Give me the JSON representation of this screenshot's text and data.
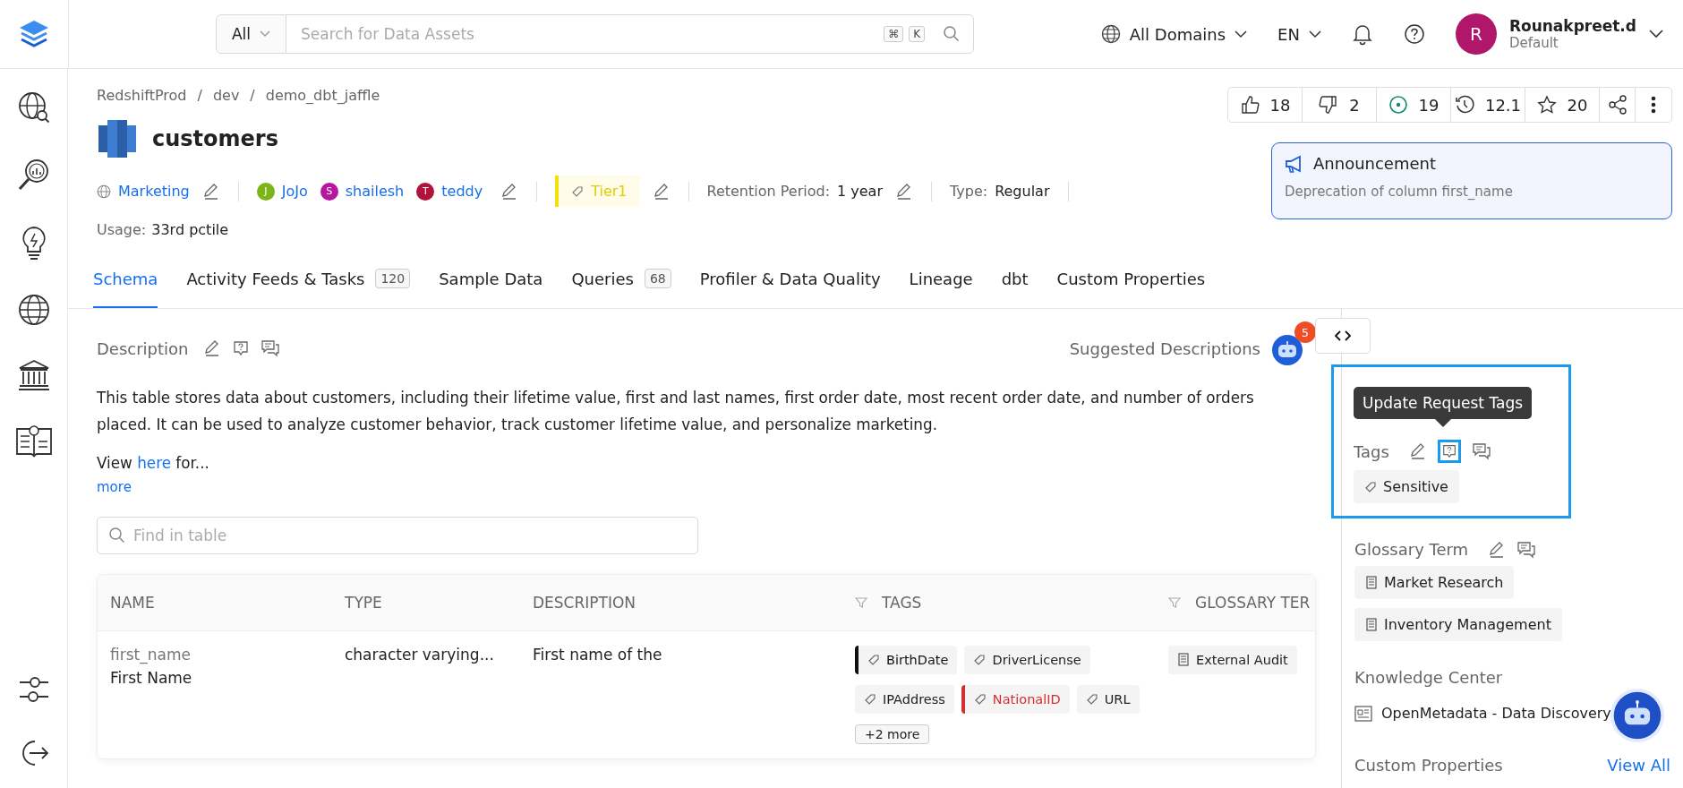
{
  "top_bar": {
    "search_scope": "All",
    "search_placeholder": "Search for Data Assets",
    "shortcut_keys": [
      "⌘",
      "K"
    ],
    "domain": "All Domains",
    "language": "EN",
    "user": {
      "initial": "R",
      "name": "Rounakpreet.d",
      "role": "Default"
    }
  },
  "breadcrumb": {
    "separator": "/",
    "items": [
      "RedshiftProd",
      "dev",
      "demo_dbt_jaffle"
    ]
  },
  "entity": {
    "name": "customers"
  },
  "actions": [
    {
      "kind": "like",
      "count": "18"
    },
    {
      "kind": "dislike",
      "count": "2"
    },
    {
      "kind": "follow",
      "count": "19"
    },
    {
      "kind": "version",
      "count": "12.1"
    },
    {
      "kind": "star",
      "count": "20"
    },
    {
      "kind": "share"
    },
    {
      "kind": "more"
    }
  ],
  "announcement": {
    "title": "Announcement",
    "text": "Deprecation of column first_name"
  },
  "meta": {
    "domain": "Marketing",
    "owners": [
      {
        "initial": "J",
        "name": "JoJo",
        "color": "#7cb518"
      },
      {
        "initial": "S",
        "name": "shailesh",
        "color": "#b5179e"
      },
      {
        "initial": "T",
        "name": "teddy",
        "color": "#b0143c"
      }
    ],
    "tier": "Tier1",
    "retention": {
      "label": "Retention Period:",
      "value": "1 year"
    },
    "type": {
      "label": "Type:",
      "value": "Regular"
    },
    "usage": {
      "label": "Usage:",
      "value": "33rd pctile"
    }
  },
  "tabs": [
    {
      "label": "Schema",
      "selected": true
    },
    {
      "label": "Activity Feeds & Tasks",
      "count": "120",
      "selected": false
    },
    {
      "label": "Sample Data",
      "selected": false
    },
    {
      "label": "Queries",
      "count": "68",
      "selected": false
    },
    {
      "label": "Profiler & Data Quality",
      "selected": false
    },
    {
      "label": "Lineage",
      "selected": false
    },
    {
      "label": "dbt",
      "selected": false
    },
    {
      "label": "Custom Properties",
      "selected": false
    }
  ],
  "description": {
    "title": "Description",
    "suggested_label": "Suggested Descriptions",
    "suggested_count": "5",
    "text": "This table stores data about customers, including their lifetime value, first and last names, first order date, most recent order date, and number of orders placed. It can be used to analyze customer behavior, track customer lifetime value, and personalize marketing.",
    "view_prefix": "View",
    "link": "here",
    "view_suffix": "for...",
    "more": "more"
  },
  "table": {
    "search_placeholder": "Find in table",
    "columns": [
      {
        "label": "NAME",
        "filter": false
      },
      {
        "label": "TYPE",
        "filter": false
      },
      {
        "label": "DESCRIPTION",
        "filter": false
      },
      {
        "label": "TAGS",
        "filter": true
      },
      {
        "label": "GLOSSARY TER",
        "filter": true
      }
    ],
    "rows": [
      {
        "name": "first_name",
        "display_name": "First Name",
        "type": "character varying...",
        "description": "First name of the",
        "tags": [
          {
            "label": "BirthDate",
            "color": "#111111"
          },
          {
            "label": "DriverLicense"
          },
          {
            "label": "IPAddress"
          },
          {
            "label": "NationalID",
            "color": "#d32f2f"
          },
          {
            "label": "URL"
          }
        ],
        "more_tags": "+2 more",
        "glossary": [
          "External Audit"
        ]
      }
    ]
  },
  "right_panel": {
    "tooltip": "Update Request Tags",
    "tags_title": "Tags",
    "tags": [
      "Sensitive"
    ],
    "glossary_title": "Glossary Term",
    "glossary": [
      "Market Research",
      "Inventory Management"
    ],
    "knowledge_title": "Knowledge Center",
    "articles": [
      "OpenMetadata - Data Discovery"
    ],
    "custom_title": "Custom Properties",
    "view_all": "View All"
  }
}
